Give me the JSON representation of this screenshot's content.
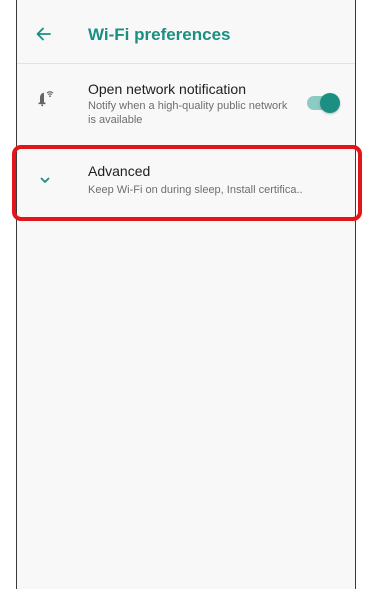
{
  "header": {
    "title": "Wi-Fi preferences",
    "back_icon": "arrow-back-icon"
  },
  "preferences": [
    {
      "icon": "wifi-notification-icon",
      "title": "Open network notification",
      "summary": "Notify when a high-quality public network is available",
      "toggle": {
        "on": true
      }
    },
    {
      "icon": "chevron-down-icon",
      "title": "Advanced",
      "summary": "Keep Wi-Fi on during sleep, Install certifica.."
    }
  ],
  "colors": {
    "accent": "#1a8f82",
    "toggle_track": "#8ccbc3",
    "highlight": "#e4141b"
  }
}
